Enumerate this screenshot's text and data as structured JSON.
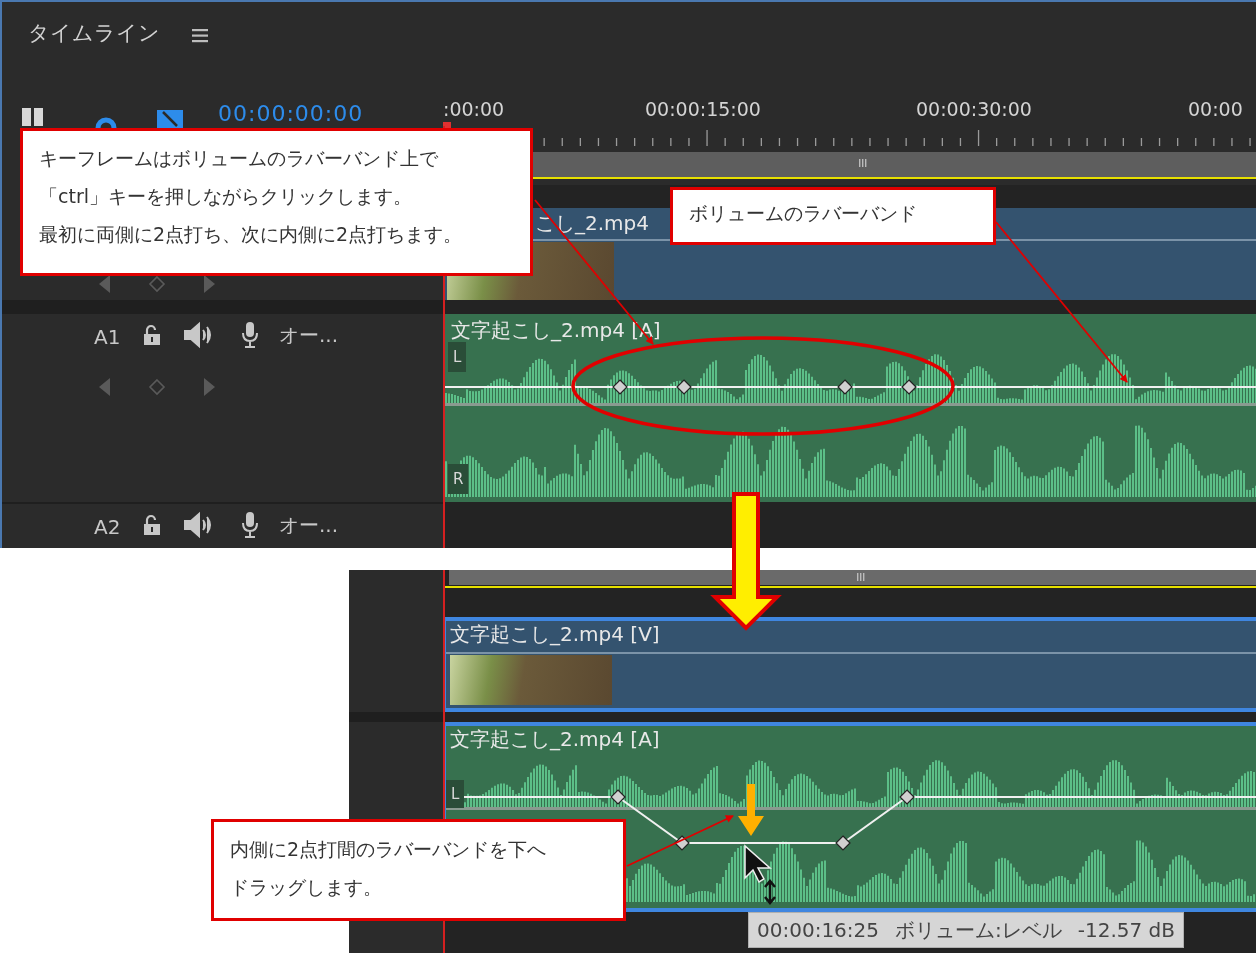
{
  "panel_title": "タイムライン",
  "timecode": "00:00:00:00",
  "ruler_labels": [
    ":00:00",
    "00:00:15:00",
    "00:00:30:00",
    "00:00"
  ],
  "top_timeline": {
    "video_clip": {
      "title": "こし_2.mp4",
      "selected": false
    },
    "audio_clip": {
      "title": "文字起こし_2.mp4 [A]",
      "selected": false,
      "channels": [
        "L",
        "R"
      ]
    },
    "tracks": [
      {
        "name": "A1",
        "label": "オー..."
      },
      {
        "name": "A2",
        "label": "オー..."
      }
    ]
  },
  "callouts": [
    {
      "lines": [
        "キーフレームはボリュームのラバーバンド上で",
        "「ctrl」キーを押しながらクリックします。",
        "最初に両側に2点打ち、次に内側に2点打ちます。"
      ]
    },
    {
      "lines": [
        "ボリュームのラバーバンド"
      ]
    },
    {
      "lines": [
        "内側に2点打間のラバーバンドを下へ",
        "ドラッグします。"
      ]
    }
  ],
  "bottom_timeline": {
    "video_clip": {
      "title": "文字起こし_2.mp4 [V]",
      "selected": true
    },
    "audio_clip": {
      "title": "文字起こし_2.mp4 [A]",
      "selected": true,
      "channels": [
        "L"
      ]
    },
    "tooltip": {
      "timecode": "00:00:16:25",
      "parameter": "ボリューム:レベル",
      "value": "-12.57 dB"
    }
  }
}
